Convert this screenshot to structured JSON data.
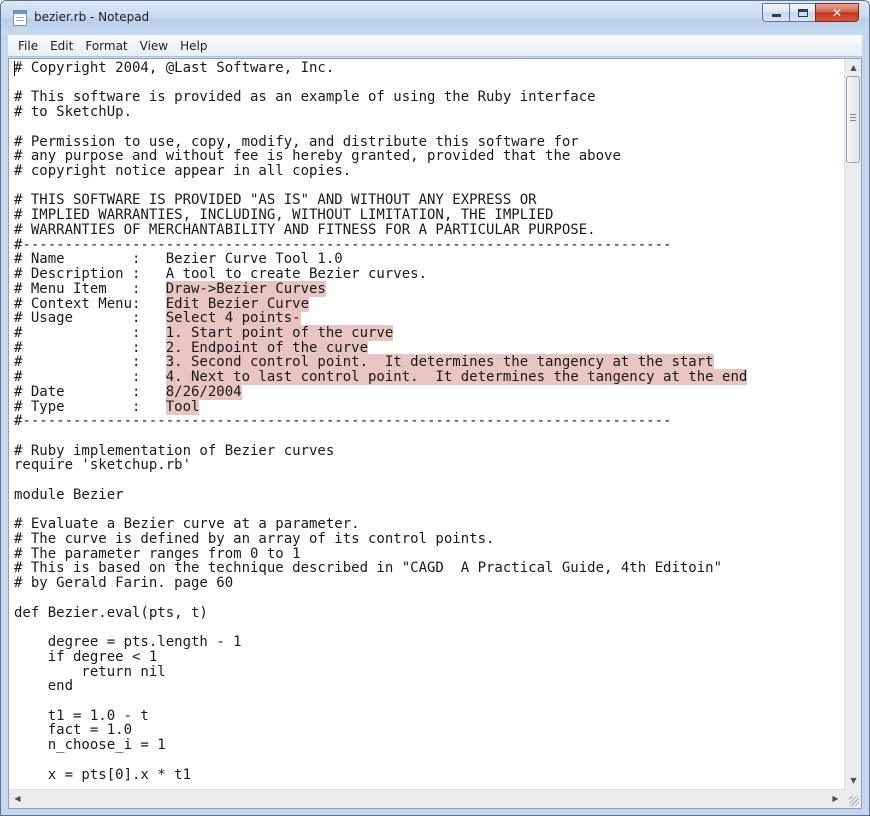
{
  "window": {
    "title": "bezier.rb - Notepad",
    "close_glyph": "✕"
  },
  "menu": [
    "File",
    "Edit",
    "Format",
    "View",
    "Help"
  ],
  "editor": {
    "highlight_color": "#e8c4c2",
    "lines": [
      {
        "t": "# Copyright 2004, @Last Software, Inc."
      },
      {
        "t": ""
      },
      {
        "t": "# This software is provided as an example of using the Ruby interface"
      },
      {
        "t": "# to SketchUp."
      },
      {
        "t": ""
      },
      {
        "t": "# Permission to use, copy, modify, and distribute this software for"
      },
      {
        "t": "# any purpose and without fee is hereby granted, provided that the above"
      },
      {
        "t": "# copyright notice appear in all copies."
      },
      {
        "t": ""
      },
      {
        "t": "# THIS SOFTWARE IS PROVIDED \"AS IS\" AND WITHOUT ANY EXPRESS OR"
      },
      {
        "t": "# IMPLIED WARRANTIES, INCLUDING, WITHOUT LIMITATION, THE IMPLIED"
      },
      {
        "t": "# WARRANTIES OF MERCHANTABILITY AND FITNESS FOR A PARTICULAR PURPOSE."
      },
      {
        "t": "#-----------------------------------------------------------------------------"
      },
      {
        "t": "# Name        :   Bezier Curve Tool 1.0"
      },
      {
        "t": "# Description :   A tool to create Bezier curves."
      },
      {
        "p": "# Menu Item   :   ",
        "h": "Draw->Bezier Curves"
      },
      {
        "p": "# Context Menu:   ",
        "h": "Edit Bezier Curve"
      },
      {
        "p": "# Usage       :   ",
        "h": "Select 4 points-"
      },
      {
        "p": "#             :   ",
        "h": "1. Start point of the curve"
      },
      {
        "p": "#             :   ",
        "h": "2. Endpoint of the curve"
      },
      {
        "p": "#             :   ",
        "h": "3. Second control point.  It determines the tangency at the start"
      },
      {
        "p": "#             :   ",
        "h": "4. Next to last control point.  It determines the tangency at the end"
      },
      {
        "p": "# Date        :   ",
        "h": "8/26/2004"
      },
      {
        "p": "# Type        :   ",
        "h": "Tool"
      },
      {
        "t": "#-----------------------------------------------------------------------------"
      },
      {
        "t": ""
      },
      {
        "t": "# Ruby implementation of Bezier curves"
      },
      {
        "t": "require 'sketchup.rb'"
      },
      {
        "t": ""
      },
      {
        "t": "module Bezier"
      },
      {
        "t": ""
      },
      {
        "t": "# Evaluate a Bezier curve at a parameter."
      },
      {
        "t": "# The curve is defined by an array of its control points."
      },
      {
        "t": "# The parameter ranges from 0 to 1"
      },
      {
        "t": "# This is based on the technique described in \"CAGD  A Practical Guide, 4th Editoin\""
      },
      {
        "t": "# by Gerald Farin. page 60"
      },
      {
        "t": ""
      },
      {
        "t": "def Bezier.eval(pts, t)"
      },
      {
        "t": ""
      },
      {
        "t": "    degree = pts.length - 1"
      },
      {
        "t": "    if degree < 1"
      },
      {
        "t": "        return nil"
      },
      {
        "t": "    end"
      },
      {
        "t": ""
      },
      {
        "t": "    t1 = 1.0 - t"
      },
      {
        "t": "    fact = 1.0"
      },
      {
        "t": "    n_choose_i = 1"
      },
      {
        "t": ""
      },
      {
        "t": "    x = pts[0].x * t1"
      }
    ]
  },
  "scrollbars": {
    "vertical_scroll_fraction": 0.0,
    "up_glyph": "▲",
    "down_glyph": "▼",
    "left_glyph": "◀",
    "right_glyph": "▶"
  }
}
